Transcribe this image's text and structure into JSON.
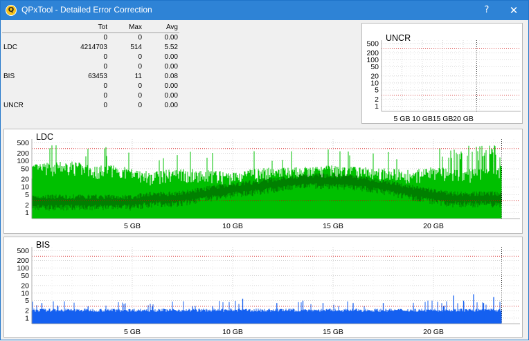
{
  "window": {
    "title": "QPxTool - Detailed Error Correction",
    "help_label": "?",
    "close_label": "✕",
    "app_icon": "qpxtool-icon",
    "icon_glyph": "Q"
  },
  "stats": {
    "headers": {
      "label": "",
      "tot": "Tot",
      "max": "Max",
      "avg": "Avg"
    },
    "rows": [
      {
        "label": "",
        "tot": "0",
        "max": "0",
        "avg": "0.00"
      },
      {
        "label": "LDC",
        "tot": "4214703",
        "max": "514",
        "avg": "5.52"
      },
      {
        "label": "",
        "tot": "0",
        "max": "0",
        "avg": "0.00"
      },
      {
        "label": "",
        "tot": "0",
        "max": "0",
        "avg": "0.00"
      },
      {
        "label": "BIS",
        "tot": "63453",
        "max": "11",
        "avg": "0.08"
      },
      {
        "label": "",
        "tot": "0",
        "max": "0",
        "avg": "0.00"
      },
      {
        "label": "",
        "tot": "0",
        "max": "0",
        "avg": "0.00"
      },
      {
        "label": "UNCR",
        "tot": "0",
        "max": "0",
        "avg": "0.00"
      }
    ]
  },
  "chart_data": [
    {
      "type": "area",
      "title": "UNCR",
      "x_unit": "GB",
      "y_scale": "log",
      "y_ticks": [
        "500",
        "200",
        "100",
        "50",
        "20",
        "10",
        "5",
        "2",
        "1"
      ],
      "x_ticks": [
        "5 GB",
        "10 GB",
        "15 GB",
        "20 GB"
      ],
      "xlim": [
        0,
        25
      ],
      "data_end_gb": 23.3,
      "threshold_lines": [
        300,
        3
      ],
      "series": [
        {
          "color": "#ff0000",
          "values": []
        }
      ]
    },
    {
      "type": "area",
      "title": "LDC",
      "x_unit": "GB",
      "y_scale": "log",
      "y_ticks": [
        "500",
        "200",
        "100",
        "50",
        "20",
        "10",
        "5",
        "2",
        "1"
      ],
      "x_ticks": [
        "5 GB",
        "10 GB",
        "15 GB",
        "20 GB"
      ],
      "xlim": [
        0,
        23.4
      ],
      "data_end_gb": 23.4,
      "threshold_lines": [
        300,
        3
      ],
      "series": [
        {
          "color": "#00c000",
          "role": "peak",
          "x": [
            0,
            1,
            2,
            3,
            4,
            5,
            6,
            7,
            8,
            9,
            10,
            11,
            12,
            13,
            14,
            15,
            16,
            17,
            18,
            19,
            20,
            21,
            22,
            23.4
          ],
          "values": [
            60,
            70,
            80,
            50,
            60,
            40,
            30,
            40,
            40,
            35,
            30,
            40,
            45,
            45,
            50,
            55,
            50,
            45,
            40,
            35,
            50,
            40,
            40,
            60
          ]
        },
        {
          "color": "#008000",
          "role": "average",
          "x": [
            0,
            1,
            2,
            3,
            4,
            5,
            6,
            7,
            8,
            9,
            10,
            11,
            12,
            13,
            14,
            15,
            16,
            17,
            18,
            19,
            20,
            21,
            22,
            23.4
          ],
          "values": [
            3,
            3,
            3,
            3,
            3,
            3,
            4,
            4,
            5,
            7,
            9,
            11,
            14,
            18,
            20,
            20,
            18,
            14,
            10,
            7,
            5,
            4,
            4,
            4
          ]
        }
      ]
    },
    {
      "type": "bar",
      "title": "BIS",
      "x_unit": "GB",
      "y_scale": "log",
      "y_ticks": [
        "500",
        "200",
        "100",
        "50",
        "20",
        "10",
        "5",
        "2",
        "1"
      ],
      "x_ticks": [
        "5 GB",
        "10 GB",
        "15 GB",
        "20 GB"
      ],
      "xlim": [
        0,
        23.4
      ],
      "data_end_gb": 23.4,
      "threshold_lines": [
        300,
        3
      ],
      "series": [
        {
          "color": "#1560f0",
          "base_value": 2,
          "spikes_gb": [
            0.5,
            1.3,
            2.8,
            6.0,
            8.0,
            9.0,
            10.5,
            12.2,
            13.5,
            14.5,
            16.0,
            17.5,
            19.0,
            20.5,
            21.0,
            21.5,
            22.0,
            22.5,
            23.0
          ],
          "spike_values": [
            4,
            3,
            3,
            3,
            3,
            3,
            6,
            4,
            5,
            4,
            4,
            4,
            3,
            3,
            8,
            5,
            9,
            4,
            7
          ]
        }
      ]
    }
  ]
}
